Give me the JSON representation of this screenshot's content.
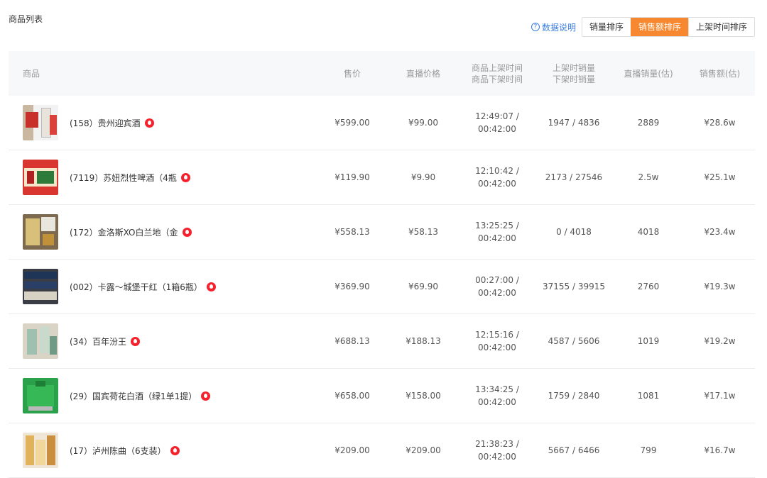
{
  "page": {
    "title": "商品列表"
  },
  "toolbar": {
    "help_label": "数据说明",
    "help_icon": "question-circle-icon",
    "sort_buttons": [
      {
        "label": "销量排序",
        "active": false
      },
      {
        "label": "销售额排序",
        "active": true
      },
      {
        "label": "上架时间排序",
        "active": false
      }
    ]
  },
  "colors": {
    "accent": "#f7882f",
    "price_red": "#f05b47",
    "link_blue": "#3b7fe3",
    "hot_badge": "#f5222d"
  },
  "table": {
    "headers": {
      "product": "商品",
      "price": "售价",
      "live_price": "直播价格",
      "shelf_on_time": "商品上架时间",
      "shelf_off_time": "商品下架时间",
      "shelf_on_sales": "上架时销量",
      "shelf_off_sales": "下架时销量",
      "live_sales": "直播销量(估)",
      "revenue": "销售额(估)"
    },
    "rows": [
      {
        "name": "(158）贵州迎宾酒",
        "price": "¥599.00",
        "live_price": "¥99.00",
        "time_on": "12:49:07 /",
        "time_off": "00:42:00",
        "sales": "1947 / 4836",
        "live_sales": "2889",
        "revenue": "¥28.6w"
      },
      {
        "name": "(7119）苏妞烈性啤酒（4瓶",
        "price": "¥119.90",
        "live_price": "¥9.90",
        "time_on": "12:10:42 /",
        "time_off": "00:42:00",
        "sales": "2173 / 27546",
        "live_sales": "2.5w",
        "revenue": "¥25.1w"
      },
      {
        "name": "(172）金洛斯XO白兰地（金",
        "price": "¥558.13",
        "live_price": "¥58.13",
        "time_on": "13:25:25 /",
        "time_off": "00:42:00",
        "sales": "0 / 4018",
        "live_sales": "4018",
        "revenue": "¥23.4w"
      },
      {
        "name": "(002）卡露～城堡干红（1箱6瓶）",
        "price": "¥369.90",
        "live_price": "¥69.90",
        "time_on": "00:27:00 /",
        "time_off": "00:42:00",
        "sales": "37155 / 39915",
        "live_sales": "2760",
        "revenue": "¥19.3w"
      },
      {
        "name": "(34）百年汾王",
        "price": "¥688.13",
        "live_price": "¥188.13",
        "time_on": "12:15:16 /",
        "time_off": "00:42:00",
        "sales": "4587 / 5606",
        "live_sales": "1019",
        "revenue": "¥19.2w"
      },
      {
        "name": "(29）国宾荷花白酒（绿1单1提）",
        "price": "¥658.00",
        "live_price": "¥158.00",
        "time_on": "13:34:25 /",
        "time_off": "00:42:00",
        "sales": "1759 / 2840",
        "live_sales": "1081",
        "revenue": "¥17.1w"
      },
      {
        "name": "(17）泸州陈曲（6支装）",
        "price": "¥209.00",
        "live_price": "¥209.00",
        "time_on": "21:38:23 /",
        "time_off": "00:42:00",
        "sales": "5667 / 6466",
        "live_sales": "799",
        "revenue": "¥16.7w"
      }
    ]
  }
}
